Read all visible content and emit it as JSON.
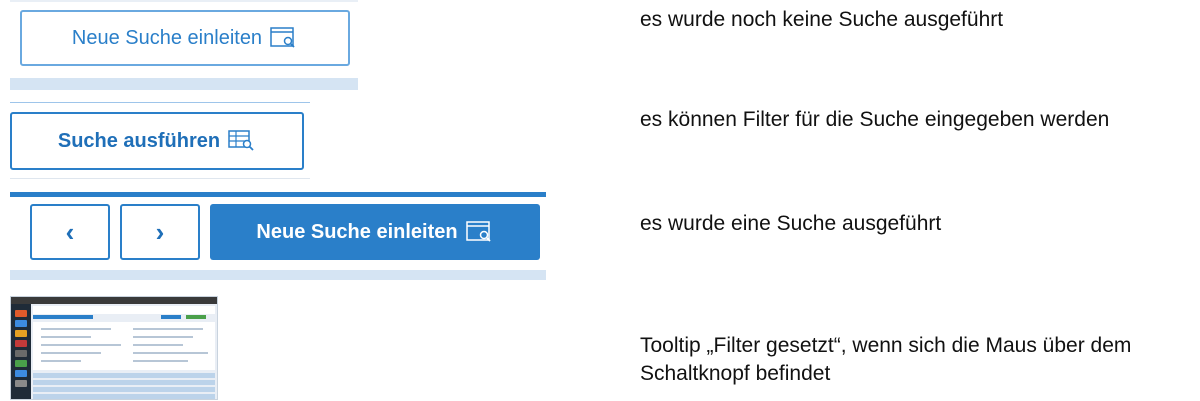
{
  "rows": [
    {
      "button_label": "Neue Suche einleiten",
      "icon": "search-window-icon",
      "description": "es wurde noch keine Suche ausgeführt"
    },
    {
      "button_label": "Suche ausführen",
      "icon": "search-table-icon",
      "description": "es können Filter für die Suche eingegeben werden"
    },
    {
      "prev_label": "‹",
      "next_label": "›",
      "button_label": "Neue Suche einleiten",
      "icon": "search-window-icon",
      "description": "es wurde eine Suche ausgeführt"
    },
    {
      "thumbnail": "application-screenshot",
      "description": "Tooltip „Filter gesetzt“, wenn sich die Maus über dem Schaltknopf befindet"
    }
  ],
  "colors": {
    "accent": "#2a7fc9",
    "light_bar": "#d5e4f3",
    "outline_light": "#6aa9e0"
  }
}
